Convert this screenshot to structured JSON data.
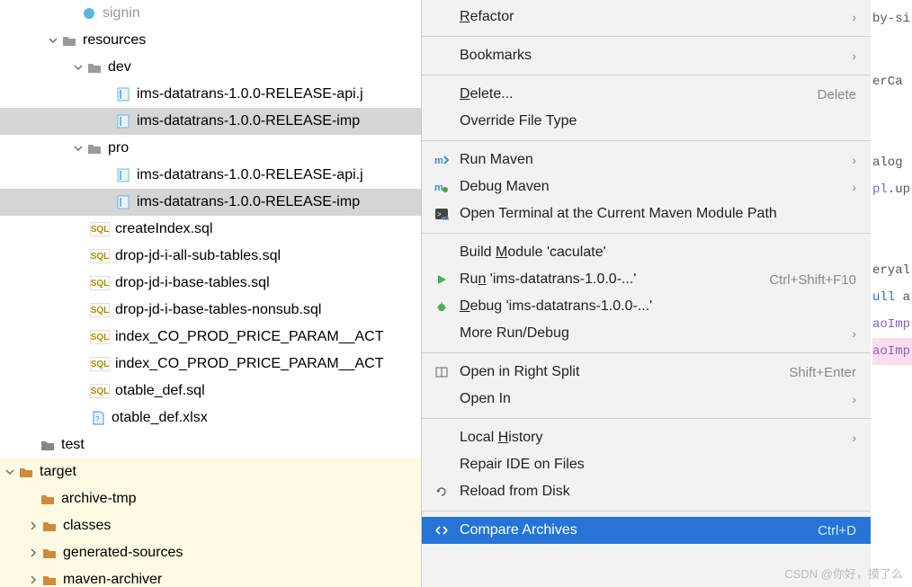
{
  "tree": {
    "signin": "signin",
    "resources": "resources",
    "dev": "dev",
    "dev_api": "ims-datatrans-1.0.0-RELEASE-api.j",
    "dev_imp": "ims-datatrans-1.0.0-RELEASE-imp",
    "pro": "pro",
    "pro_api": "ims-datatrans-1.0.0-RELEASE-api.j",
    "pro_imp": "ims-datatrans-1.0.0-RELEASE-imp",
    "createIndex": "createIndex.sql",
    "drop_all": "drop-jd-i-all-sub-tables.sql",
    "drop_base": "drop-jd-i-base-tables.sql",
    "drop_base_nonsub": "drop-jd-i-base-tables-nonsub.sql",
    "index_co1": "index_CO_PROD_PRICE_PARAM__ACT",
    "index_co2": "index_CO_PROD_PRICE_PARAM__ACT",
    "otable_sql": "otable_def.sql",
    "otable_xlsx": "otable_def.xlsx",
    "test": "test",
    "target": "target",
    "archive_tmp": "archive-tmp",
    "classes": "classes",
    "generated_sources": "generated-sources",
    "maven_archiver": "maven-archiver"
  },
  "menu": {
    "refactor": "Refactor",
    "bookmarks": "Bookmarks",
    "delete": "Delete...",
    "delete_shortcut": "Delete",
    "override": "Override File Type",
    "run_maven": "Run Maven",
    "debug_maven": "Debug Maven",
    "open_terminal": "Open Terminal at the Current Maven Module Path",
    "build_module": "Build Module 'caculate'",
    "run_ims": "Run 'ims-datatrans-1.0.0-...'",
    "run_ims_shortcut": "Ctrl+Shift+F10",
    "debug_ims": "Debug 'ims-datatrans-1.0.0-...'",
    "more_run": "More Run/Debug",
    "open_right": "Open in Right Split",
    "open_right_shortcut": "Shift+Enter",
    "open_in": "Open In",
    "local_history": "Local History",
    "repair_ide": "Repair IDE on Files",
    "reload_disk": "Reload from Disk",
    "compare_archives": "Compare Archives",
    "compare_shortcut": "Ctrl+D"
  },
  "editor": {
    "l1": "by-si",
    "l2": "erCa",
    "l3": "alog",
    "l4a": "pl",
    "l4b": ".up",
    "l5": "eryal",
    "l6a": "ull ",
    "l6b": "a",
    "l7": "aoImp",
    "l8": "aoImp"
  },
  "watermark": "CSDN @你好，摸了么"
}
